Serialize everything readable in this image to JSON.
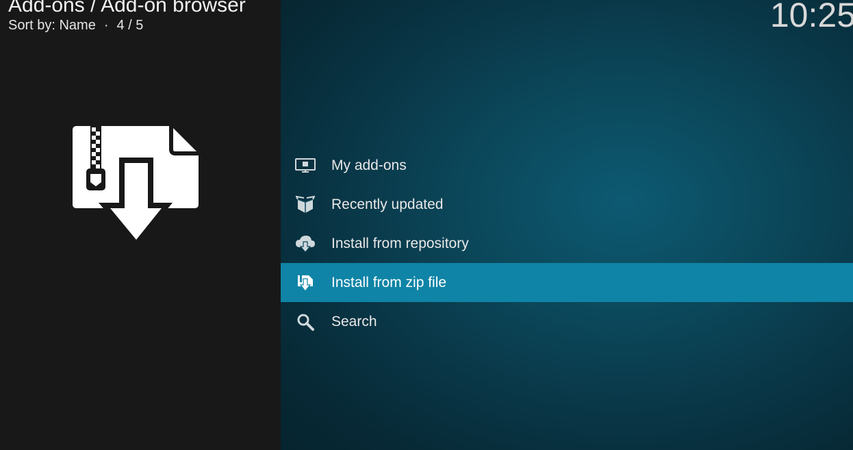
{
  "header": {
    "title": "Add-ons / Add-on browser",
    "sort_label": "Sort by: Name",
    "separator": "·",
    "position": "4 / 5"
  },
  "clock": "10:25",
  "preview": {
    "icon": "zip-download-icon"
  },
  "menu": {
    "items": [
      {
        "label": "My add-ons",
        "icon": "monitor-addon-icon",
        "selected": false
      },
      {
        "label": "Recently updated",
        "icon": "open-box-icon",
        "selected": false
      },
      {
        "label": "Install from repository",
        "icon": "cloud-download-icon",
        "selected": false
      },
      {
        "label": "Install from zip file",
        "icon": "zip-file-icon",
        "selected": true
      },
      {
        "label": "Search",
        "icon": "search-icon",
        "selected": false
      }
    ]
  },
  "colors": {
    "selected_row": "#0f84a6",
    "left_panel": "#181818",
    "right_panel": "#0b4659"
  }
}
